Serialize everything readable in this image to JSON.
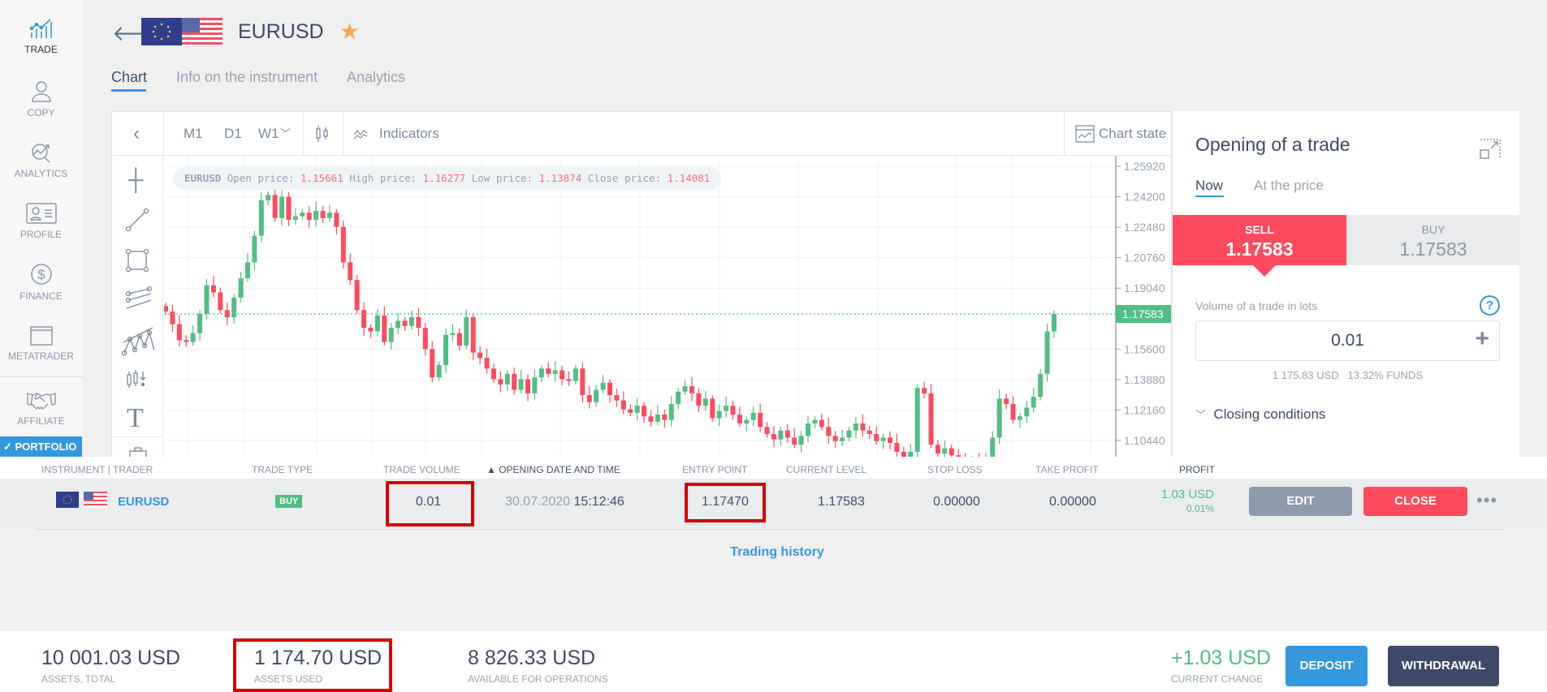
{
  "sidebar": {
    "items": [
      {
        "label": "TRADE",
        "icon": "trade-chart-icon",
        "active": true
      },
      {
        "label": "COPY",
        "icon": "trader-person-icon"
      },
      {
        "label": "ANALYTICS",
        "icon": "analytics-magnifier-icon"
      },
      {
        "label": "PROFILE",
        "icon": "profile-card-icon"
      },
      {
        "label": "FINANCE",
        "icon": "dollar-circle-icon"
      },
      {
        "label": "METATRADER",
        "icon": "window-icon"
      },
      {
        "label": "AFFILIATE",
        "icon": "handshake-icon"
      }
    ],
    "portfolio_label": "PORTFOLIO"
  },
  "header": {
    "symbol": "EURUSD",
    "favorite": true
  },
  "tabs": [
    {
      "label": "Chart",
      "active": true
    },
    {
      "label": "Info on the instrument"
    },
    {
      "label": "Analytics"
    }
  ],
  "toolbar": {
    "timeframes": [
      "M1",
      "D1",
      "W1"
    ],
    "indicators_label": "Indicators",
    "chart_state_label": "Chart state"
  },
  "tooltip": {
    "symbol": "EURUSD",
    "open_label": "Open price:",
    "open": "1.15661",
    "high_label": "High price:",
    "high": "1.16277",
    "low_label": "Low price:",
    "low": "1.13874",
    "close_label": "Close price:",
    "close": "1.14081"
  },
  "chart_data": {
    "type": "candlestick",
    "y_ticks": [
      "1.25920",
      "1.24200",
      "1.22480",
      "1.20760",
      "1.19040",
      "1.15600",
      "1.13880",
      "1.12160",
      "1.10440"
    ],
    "ylim": [
      1.0953,
      1.264
    ],
    "current_price": "1.17583",
    "grid": true,
    "colors": {
      "up": "#52bd84",
      "down": "#ff4a5e"
    },
    "closes": [
      1.1772,
      1.17,
      1.161,
      1.16,
      1.165,
      1.176,
      1.192,
      1.188,
      1.178,
      1.174,
      1.185,
      1.196,
      1.205,
      1.22,
      1.24,
      1.243,
      1.23,
      1.242,
      1.229,
      1.231,
      1.233,
      1.229,
      1.234,
      1.23,
      1.233,
      1.225,
      1.205,
      1.195,
      1.178,
      1.168,
      1.166,
      1.175,
      1.16,
      1.168,
      1.172,
      1.169,
      1.174,
      1.168,
      1.156,
      1.14,
      1.147,
      1.164,
      1.165,
      1.158,
      1.174,
      1.154,
      1.151,
      1.145,
      1.139,
      1.136,
      1.142,
      1.133,
      1.139,
      1.131,
      1.14,
      1.145,
      1.142,
      1.144,
      1.139,
      1.138,
      1.145,
      1.13,
      1.126,
      1.133,
      1.137,
      1.13,
      1.127,
      1.122,
      1.12,
      1.124,
      1.118,
      1.115,
      1.119,
      1.116,
      1.125,
      1.132,
      1.135,
      1.131,
      1.124,
      1.128,
      1.117,
      1.121,
      1.124,
      1.119,
      1.114,
      1.116,
      1.12,
      1.112,
      1.108,
      1.105,
      1.11,
      1.106,
      1.102,
      1.107,
      1.114,
      1.116,
      1.112,
      1.107,
      1.104,
      1.106,
      1.11,
      1.114,
      1.11,
      1.108,
      1.104,
      1.106,
      1.103,
      1.098,
      1.095,
      1.098,
      1.134,
      1.131,
      1.102,
      1.097,
      1.1,
      1.096,
      1.092,
      1.09,
      1.093,
      1.091,
      1.095,
      1.106,
      1.128,
      1.125,
      1.116,
      1.118,
      1.123,
      1.129,
      1.142,
      1.166,
      1.17583
    ]
  },
  "trade_panel": {
    "title": "Opening of a trade",
    "tabs": [
      "Now",
      "At the price"
    ],
    "sell_label": "SELL",
    "sell_price": "1.17583",
    "buy_label": "BUY",
    "buy_price": "1.17583",
    "volume_label": "Volume of a trade in lots",
    "volume": "0.01",
    "cost": "1 175.83 USD",
    "funds": "13.32% FUNDS",
    "closing_conditions": "Closing conditions"
  },
  "table": {
    "headers": [
      "INSTRUMENT | TRADER",
      "TRADE TYPE",
      "TRADE VOLUME",
      "OPENING DATE AND TIME",
      "ENTRY POINT",
      "CURRENT LEVEL",
      "STOP LOSS",
      "TAKE PROFIT",
      "PROFIT"
    ],
    "rows": [
      {
        "instrument": "EURUSD",
        "type": "BUY",
        "volume": "0.01",
        "date": "30.07.2020",
        "time": "15:12:46",
        "entry": "1.17470",
        "current": "1.17583",
        "stop_loss": "0.00000",
        "take_profit": "0.00000",
        "profit": "1.03 USD",
        "profit_pct": "0.01%",
        "edit": "EDIT",
        "close": "CLOSE"
      }
    ],
    "history_link": "Trading history"
  },
  "footer": {
    "total": "10 001.03 USD",
    "total_label": "ASSETS, TOTAL",
    "used": "1 174.70 USD",
    "used_label": "ASSETS USED",
    "available": "8 826.33 USD",
    "available_label": "AVAILABLE FOR OPERATIONS",
    "change": "+1.03 USD",
    "change_label": "CURRENT CHANGE",
    "deposit": "DEPOSIT",
    "withdrawal": "WITHDRAWAL"
  },
  "colors": {
    "accent": "#3598dc",
    "sell": "#ff4a5e",
    "buy_profit": "#52bd84",
    "dark": "#3d4966"
  }
}
